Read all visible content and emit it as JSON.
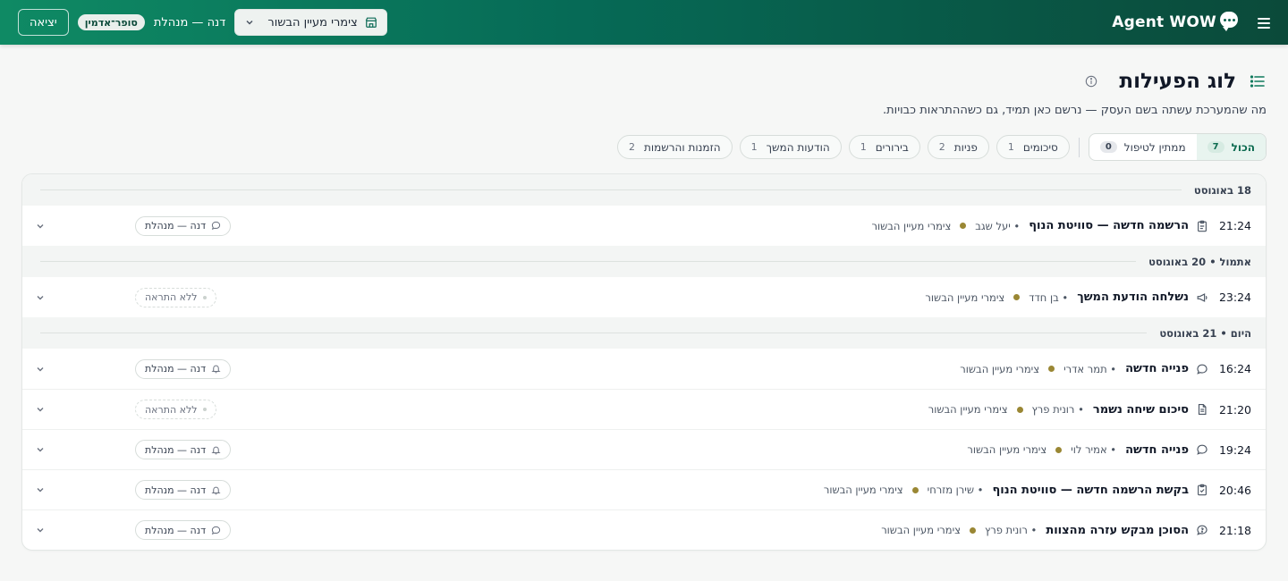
{
  "header": {
    "brand": "Agent WOW",
    "business_select": "צימרי מעיין הבשור",
    "user_name": "דנה — מנהלת",
    "role_badge": "סופר־אדמין",
    "logout_label": "יציאה"
  },
  "page": {
    "title": "לוג הפעילות",
    "subtitle": "מה שהמערכת עשתה בשם העסק — נרשם כאן תמיד, גם כשההתראות כבויות."
  },
  "filters": {
    "segment": [
      {
        "label": "הכול",
        "count": "7",
        "active": true
      },
      {
        "label": "ממתין לטיפול",
        "count": "0",
        "active": false
      }
    ],
    "chips": [
      {
        "label": "סיכומים",
        "count": "1"
      },
      {
        "label": "פניות",
        "count": "2"
      },
      {
        "label": "בירורים",
        "count": "1"
      },
      {
        "label": "הודעות המשך",
        "count": "1"
      },
      {
        "label": "הזמנות והרשמות",
        "count": "2"
      }
    ]
  },
  "groups": [
    {
      "label": "18 באוגוסט",
      "rows": [
        {
          "time": "21:24",
          "icon": "clipboard-icon",
          "title": "הרשמה חדשה — סוויטת הנוף",
          "person": "• יעל שגב",
          "biz": "צימרי מעיין הבשור",
          "notif": "דנה — מנהלת",
          "notif_type": "chat"
        }
      ]
    },
    {
      "label": "אתמול • 20 באוגוסט",
      "rows": [
        {
          "time": "23:24",
          "icon": "megaphone-icon",
          "title": "נשלחה הודעת המשך",
          "person": "• בן חדד",
          "biz": "צימרי מעיין הבשור",
          "notif": "ללא התראה",
          "notif_type": "none"
        }
      ]
    },
    {
      "label": "היום • 21 באוגוסט",
      "rows": [
        {
          "time": "16:24",
          "icon": "chat-bubble-icon",
          "title": "פנייה חדשה",
          "person": "• תמר אדרי",
          "biz": "צימרי מעיין הבשור",
          "notif": "דנה — מנהלת",
          "notif_type": "bell"
        },
        {
          "time": "21:20",
          "icon": "document-icon",
          "title": "סיכום שיחה נשמר",
          "person": "• רונית פרץ",
          "biz": "צימרי מעיין הבשור",
          "notif": "ללא התראה",
          "notif_type": "none"
        },
        {
          "time": "19:24",
          "icon": "chat-bubble-icon",
          "title": "פנייה חדשה",
          "person": "• אמיר לוי",
          "biz": "צימרי מעיין הבשור",
          "notif": "דנה — מנהלת",
          "notif_type": "bell"
        },
        {
          "time": "20:46",
          "icon": "clipboard-check-icon",
          "title": "בקשת הרשמה חדשה — סוויטת הנוף",
          "person": "• שירן מזרחי",
          "biz": "צימרי מעיין הבשור",
          "notif": "דנה — מנהלת",
          "notif_type": "bell"
        },
        {
          "time": "21:18",
          "icon": "help-bubble-icon",
          "title": "הסוכן מבקש עזרה מהצוות",
          "person": "• רונית פרץ",
          "biz": "צימרי מעיין הבשור",
          "notif": "דנה — מנהלת",
          "notif_type": "chat"
        }
      ]
    }
  ],
  "colors": {
    "header_start": "#0f8a64",
    "header_end": "#0b4a3a",
    "accent": "#0b6a4f",
    "biz_dot": "#9a8734"
  }
}
